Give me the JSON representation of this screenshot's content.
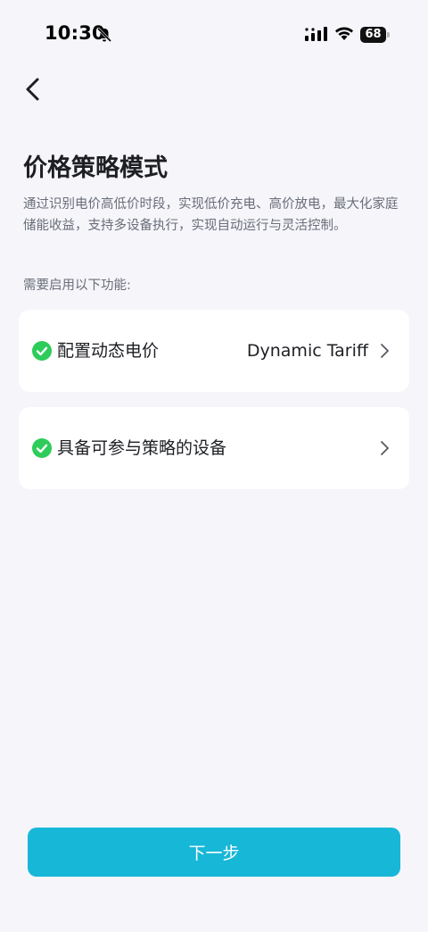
{
  "status_bar": {
    "time": "10:30",
    "battery_level": "68",
    "icons": [
      "bell-off-icon",
      "signal-icon",
      "wifi-icon",
      "battery-icon"
    ]
  },
  "header": {
    "back_icon": "chevron-left-icon"
  },
  "page": {
    "title": "价格策略模式",
    "description": "通过识别电价高低价时段，实现低价充电、高价放电，最大化家庭储能收益，支持多设备执行，实现自动运行与灵活控制。",
    "section_label": "需要启用以下功能:"
  },
  "requirements": [
    {
      "label": "配置动态电价",
      "value": "Dynamic Tariff",
      "status_icon": "check-circle-icon",
      "arrow_icon": "chevron-right-icon"
    },
    {
      "label": "具备可参与策略的设备",
      "value": "",
      "status_icon": "check-circle-icon",
      "arrow_icon": "chevron-right-icon"
    }
  ],
  "footer": {
    "next_label": "下一步"
  },
  "colors": {
    "background": "#f5f5fa",
    "card": "#ffffff",
    "accent": "#17b7d7",
    "check": "#2ecc5a",
    "text_primary": "#1d1f23",
    "text_secondary": "#6a6e78"
  }
}
